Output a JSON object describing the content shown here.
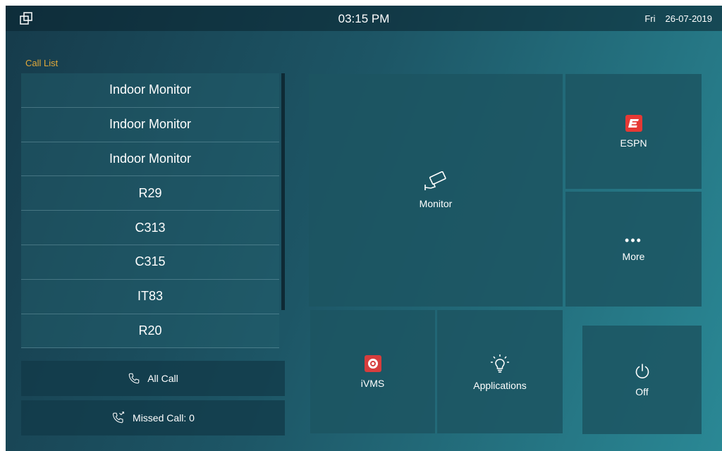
{
  "status_bar": {
    "time": "03:15 PM",
    "day": "Fri",
    "date": "26-07-2019"
  },
  "call_list": {
    "title": "Call List",
    "items": [
      "Indoor Monitor",
      "Indoor Monitor",
      "Indoor Monitor",
      "R29",
      "C313",
      "C315",
      "IT83",
      "R20"
    ]
  },
  "buttons": {
    "all_call": "All Call",
    "missed_call": "Missed Call: 0"
  },
  "tiles": {
    "monitor": "Monitor",
    "espn": "ESPN",
    "more": "More",
    "ivms": "iVMS",
    "applications": "Applications",
    "off": "Off"
  },
  "icons": {
    "window": "window-icon",
    "phone": "phone-icon",
    "missed_call": "missed-call-icon",
    "camera": "camera-icon",
    "espn": "espn-logo-icon",
    "more": "more-dots-icon",
    "ivms": "ivms-logo-icon",
    "lightbulb": "lightbulb-icon",
    "power": "power-icon"
  },
  "colors": {
    "accent": "#e2a93a",
    "espn": "#e53935",
    "ivms": "#d63d3d"
  }
}
